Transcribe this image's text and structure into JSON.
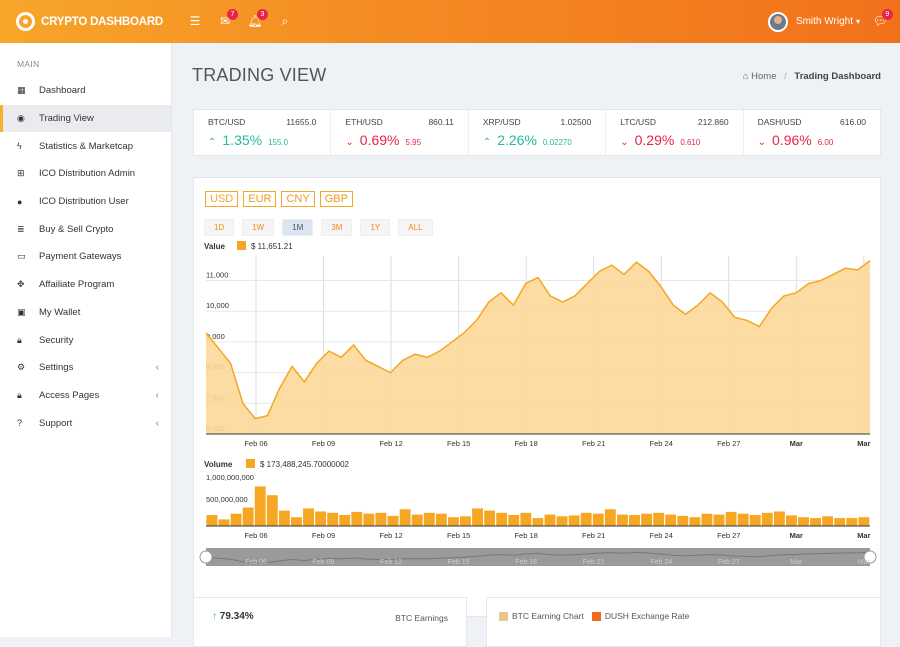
{
  "app": {
    "title": "CRYPTO DASHBOARD"
  },
  "topbar": {
    "mail_badge": "7",
    "bell_badge": "3",
    "user_name": "Smith Wright",
    "chat_badge": "9"
  },
  "sidebar": {
    "heading": "MAIN",
    "items": [
      {
        "label": "Dashboard",
        "icon": "grid-icon"
      },
      {
        "label": "Trading View",
        "icon": "target-icon"
      },
      {
        "label": "Statistics & Marketcap",
        "icon": "bolt-icon"
      },
      {
        "label": "ICO Distribution Admin",
        "icon": "sitemap-icon"
      },
      {
        "label": "ICO Distribution User",
        "icon": "user-icon"
      },
      {
        "label": "Buy & Sell Crypto",
        "icon": "database-icon"
      },
      {
        "label": "Payment Gateways",
        "icon": "credit-card-icon"
      },
      {
        "label": "Affailiate Program",
        "icon": "move-icon"
      },
      {
        "label": "My Wallet",
        "icon": "wallet-icon"
      },
      {
        "label": "Security",
        "icon": "lock-icon"
      },
      {
        "label": "Settings",
        "icon": "gear-icon"
      },
      {
        "label": "Access Pages",
        "icon": "lock-icon"
      },
      {
        "label": "Support",
        "icon": "help-icon"
      }
    ]
  },
  "page": {
    "title": "TRADING VIEW"
  },
  "breadcrumb": {
    "home": "Home",
    "separator": "/",
    "current": "Trading Dashboard"
  },
  "tickers": [
    {
      "pair": "BTC/USD",
      "price": "11655.0",
      "pct": "1.35%",
      "change": "155.0",
      "dir": "up"
    },
    {
      "pair": "ETH/USD",
      "price": "860.11",
      "pct": "0.69%",
      "change": "5.95",
      "dir": "down"
    },
    {
      "pair": "XRP/USD",
      "price": "1.02500",
      "pct": "2.26%",
      "change": "0.02270",
      "dir": "up"
    },
    {
      "pair": "LTC/USD",
      "price": "212.860",
      "pct": "0.29%",
      "change": "0.610",
      "dir": "down"
    },
    {
      "pair": "DASH/USD",
      "price": "616.00",
      "pct": "0.96%",
      "change": "6.00",
      "dir": "down"
    }
  ],
  "currencies": [
    "USD",
    "EUR",
    "CNY",
    "GBP"
  ],
  "selected_currency": "USD",
  "ranges": [
    "1D",
    "1W",
    "1M",
    "3M",
    "1Y",
    "ALL"
  ],
  "selected_range": "1M",
  "chart_data": {
    "type": "area",
    "value_legend": "Value",
    "value_readout": "$ 11,651.21",
    "volume_legend": "Volume",
    "volume_readout": "$ 173,488,245.70000002",
    "x_ticks": [
      "Feb 06",
      "Feb 09",
      "Feb 12",
      "Feb 15",
      "Feb 18",
      "Feb 21",
      "Feb 24",
      "Feb 27",
      "Mar",
      "Mar"
    ],
    "y_ticks": [
      "6,000",
      "7,000",
      "8,000",
      "9,000",
      "10,000",
      "11,000"
    ],
    "ylim": [
      6000,
      11800
    ],
    "values": [
      9300,
      8800,
      8300,
      7000,
      6500,
      6600,
      7500,
      8200,
      7700,
      8300,
      8700,
      8500,
      8900,
      8400,
      8200,
      8000,
      8400,
      8600,
      8500,
      8700,
      9000,
      9300,
      9700,
      10300,
      10600,
      10200,
      10900,
      11100,
      10500,
      10300,
      10500,
      10900,
      11300,
      11500,
      11200,
      11600,
      11300,
      10800,
      10200,
      9900,
      10200,
      10600,
      10300,
      9800,
      9700,
      9500,
      10100,
      10500,
      10600,
      10900,
      11000,
      11200,
      11400,
      11350,
      11650
    ],
    "vol_ticks": [
      "1,000,000,000",
      "500,000,000",
      "0"
    ],
    "vol_ylim": [
      0,
      1000000000
    ],
    "volumes": [
      250,
      150,
      280,
      420,
      900,
      700,
      350,
      200,
      400,
      330,
      300,
      250,
      320,
      280,
      300,
      230,
      380,
      260,
      300,
      280,
      200,
      220,
      400,
      350,
      300,
      250,
      300,
      180,
      260,
      220,
      240,
      300,
      280,
      380,
      260,
      250,
      280,
      300,
      260,
      230,
      200,
      280,
      260,
      320,
      280,
      250,
      300,
      330,
      240,
      200,
      180,
      220,
      180,
      180,
      200
    ],
    "navigator_ticks": [
      "Feb 06",
      "Feb 09",
      "Feb 12",
      "Feb 15",
      "Feb 18",
      "Feb 21",
      "Feb 24",
      "Feb 27",
      "Mar",
      "Mar"
    ]
  },
  "earnings": {
    "pct": "79.34%",
    "label": "BTC Earnings"
  },
  "legend2": {
    "item1": "BTC Earning Chart",
    "item2": "DUSH Exchange Rate"
  },
  "colors": {
    "accent": "#f5a623",
    "area_fill": "#fcd898",
    "up": "#26b99a",
    "down": "#e8234b"
  }
}
